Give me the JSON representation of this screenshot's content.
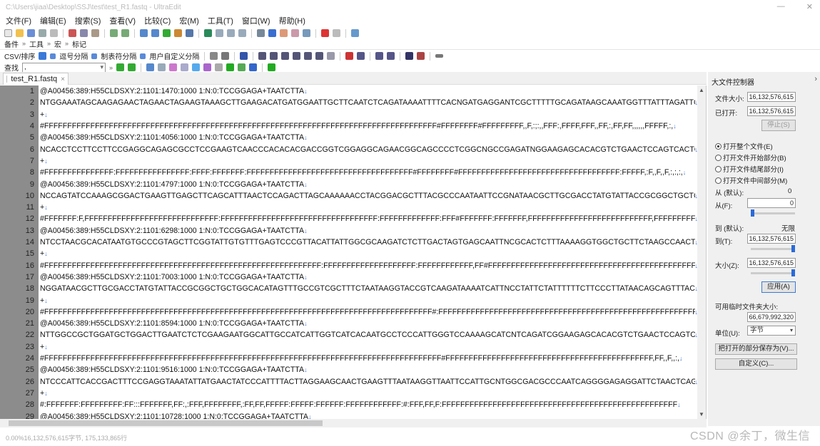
{
  "window": {
    "title": "C:\\Users\\jiaa\\Desktop\\SSJ\\test\\test_R1.fastq - UltraEdit"
  },
  "menu": [
    "文件(F)",
    "编辑(E)",
    "搜索(S)",
    "查看(V)",
    "比较(C)",
    "宏(M)",
    "工具(T)",
    "窗口(W)",
    "帮助(H)"
  ],
  "toolbar2": {
    "items": [
      "备件",
      "工具",
      "宏",
      "标记"
    ]
  },
  "toolbar3": {
    "csv": "CSV/排序",
    "sep1": "逗号分隔",
    "sep2": "制表符分隔",
    "sep3": "用户自定义分隔"
  },
  "toolbar4": {
    "find_label": "查找",
    "find_value": ","
  },
  "tab": {
    "label": "test_R1.fastq",
    "close": "×"
  },
  "editor": {
    "lines": [
      {
        "n": "1",
        "text": "@A00456:389:H55CLDSXY:2:1101:1470:1000 1:N:0:TCCGGAGA+TAATCTTA"
      },
      {
        "n": "2",
        "text": "NTGGAAATAGCAAGAGAACTAGAACTAGAAGTAAAGCTTGAAGACATGATGGAATTGCTTCAATCTCAGATAAAATTTTCACNGATGAGGANTCGCTTTTTGCAGATAAGCAAATGGTTTATTTAGATTGTAT"
      },
      {
        "n": "3",
        "text": "+"
      },
      {
        "n": "4",
        "text": "#FFFFFFFFFFFFFFFFFFFFFFFFFFFFFFFFFFFFFFFFFFFFFFFFFFFFFFFFFFFFFFFFFFFFFFFFFFFFFFFFFFFFF#FFFFFFFF#FFFFFFFFF,,F,:;:,,FFF:,FFFF,FFF,,FF,:,FF,FF,,,,,,FFFFF,:,"
      },
      {
        "n": "5",
        "text": "@A00456:389:H55CLDSXY:2:1101:4056:1000 1:N:0:TCCGGAGA+TAATCTTA"
      },
      {
        "n": "6",
        "text": "NCACCTCCTTCCTTCCGAGGCAGAGCGCCTCCGAAGTCAACCCACACACGACCGGTCGGAGGCAGAACGGCAGCCCCTCGGCNGCCGAGATNGGAAGAGCACACGTCTGAACTCCAGTCACTCCGGAGAAT"
      },
      {
        "n": "7",
        "text": "+"
      },
      {
        "n": "8",
        "text": "#FFFFFFFFFFFFFFF:FFFFFFFFFFFFFFFF:FFFF:FFFFFFF:FFFFFFFFFFFFFFFFFFFFFFFFFFFFFFFFFFFF#FFFFFFFF#FFFFFFFFFFFFFFFFFFFFFFFFFFFFFFFFFFF:FFFFF,:F,,F,,F,:,:,:,"
      },
      {
        "n": "9",
        "text": "@A00456:389:H55CLDSXY:2:1101:4797:1000 1:N:0:TCCGGAGA+TAATCTTA"
      },
      {
        "n": "10",
        "text": "NCCAGTATCCAAAGCGGACTGAAGTTGAGCTTCAGCATTTAACTCCAGACTTAGCAAAAAACCTACGGACGCTTTACGCCCAATAATTCCGNATAACGCTTGCGACCTATGTATTACCGCGGCTGCTGGCACAT"
      },
      {
        "n": "11",
        "text": "+"
      },
      {
        "n": "12",
        "text": "#FFFFFFF:F,FFFFFFFFFFFFFFFFFFFFFFFFFFFFF:FFFFFFFFFFFFFFFFFFFFFFFFFFFFFFFFFF:FFFFFFFFFFFFF:FFF#FFFFFFF:FFFFFFF,FFFFFFFFFFFFFFFFFFFFFFFFFFF,FFFFFFFFFFFFFF:FF"
      },
      {
        "n": "13",
        "text": "@A00456:389:H55CLDSXY:2:1101:6298:1000 1:N:0:TCCGGAGA+TAATCTTA"
      },
      {
        "n": "14",
        "text": "NTCCTAACGCACATAATGTGCCCGTAGCTTCGGTATTGTGTTTGAGTCCCGTTACATTATTGGCGCAAGATCTCTTGACTAGTGAGCAATTNCGCACTCTTTAAAAGGTGGCTGCTTCTAAGCCAACTTCTAGT"
      },
      {
        "n": "15",
        "text": "+"
      },
      {
        "n": "16",
        "text": "#FFFFFFFFFFFFFFFFFFFFFFFFFFFFFFFFFFFFFFFFFFFFFFFFFFFFFFFFFFFF:FFFFFFFFFFFFFFFFFFFF:FFFFFFFFFFFF,FF#FFFFFFFFFFFFFFFFFFFFFFFFFFFFFFFFFFFFFFFFFFFFFFFFFF"
      },
      {
        "n": "17",
        "text": "@A00456:389:H55CLDSXY:2:1101:7003:1000 1:N:0:TCCGGAGA+TAATCTTA"
      },
      {
        "n": "18",
        "text": "NGGATAACGCTTGCGACCTATGTATTACCGCGGCTGCTGGCACATAGTTTGCCGTCGCTTTCTAATAAGGTACCGTCAAGATAAAATCATTNCCTATTCTATTTTTTCTTCCCTTATAACAGCAGTTTACATTCCG"
      },
      {
        "n": "19",
        "text": "+"
      },
      {
        "n": "20",
        "text": "#FFFFFFFFFFFFFFFFFFFFFFFFFFFFFFFFFFFFFFFFFFFFFFFFFFFFFFFFFFFFFFFFFFFFFFFFFFFFFFFFFFFF#:FFFFFFFFFFFFFFFFFFFFFFFFFFFFFFFFFFFFFFFFFFFFFFFFFFFFFFFFFFFF"
      },
      {
        "n": "21",
        "text": "@A00456:389:H55CLDSXY:2:1101:8594:1000 1:N:0:TCCGGAGA+TAATCTTA"
      },
      {
        "n": "22",
        "text": "NTTGGCCGCTGGATGCTGGACTTGAATCTCTCGAAGAATGGCATTGCCATCATTGGTCATCACAATGCCTCCCATTGGGTCCAAAAGCATCNTCAGATCGGAAGAGCACACGTCTGAACTCCAGTCACTCCGG"
      },
      {
        "n": "23",
        "text": "+"
      },
      {
        "n": "24",
        "text": "#FFFFFFFFFFFFFFFFFFFFFFFFFFFFFFFFFFFFFFFFFFFFFFFFFFFFFFFFFFFFFFFFFFFFFFFFFFFFFFFFFFFFFF#FFFFFFFFFFFFFFFFFFFFFFFFFFFFFFFFFFFFFFFFFFFFF,FF,,F,,:,"
      },
      {
        "n": "25",
        "text": "@A00456:389:H55CLDSXY:2:1101:9516:1000 1:N:0:TCCGGAGA+TAATCTTA"
      },
      {
        "n": "26",
        "text": "NTCCCATTCACCGACTTTCCGAGGTAAATATTATGAACTATCCCATTTTACTTAGGAAGCAACTGAAGTTTAATAAGGTTAATTCCATTGCNTGGCGACGCCCAATCAGGGGAGAGGATTCTAACTCAGTAATC"
      },
      {
        "n": "27",
        "text": "+"
      },
      {
        "n": "28",
        "text": "#:FFFFFFF:FFFFFFFFF:FF:::FFFFFFF,FF:,:FFF,FFFFFFFF,:FF,FF,FFFFF:FFFFF:FFFFFF:FFFFFFFFFFFF:#:FFF,FF,F:FFFFFFFFFFFFFFFFFFFFFFFFFFFFFFFFFFFFFFFFFFFFFFFFFFF"
      },
      {
        "n": "29",
        "text": "@A00456:389:H55CLDSXY:2:1101:10728:1000 1:N:0:TCCGGAGA+TAATCTTA"
      }
    ]
  },
  "panel": {
    "title": "大文件控制器",
    "size_label": "文件大小:",
    "size_value": "16,132,576,615",
    "opened_label": "已打开:",
    "opened_value": "16,132,576,615",
    "stop_btn": "停止(S)",
    "radios": [
      "打开整个文件(E)",
      "打开文件开始部分(B)",
      "打开文件结尾部分(I)",
      "打开文件中间部分(M)"
    ],
    "from_default_label": "从 (默认):",
    "from_default_value": "0",
    "from_label": "从(F):",
    "from_value": "0",
    "to_default_label": "到 (默认):",
    "to_default_value": "无限",
    "to_label": "到(T):",
    "to_value": "16,132,576,615",
    "size2_label": "大小(Z):",
    "size2_value": "16,132,576,615",
    "apply_btn": "应用(A)",
    "temp_label": "可用临时文件夹大小:",
    "temp_value": "66,679,992,320",
    "unit_label": "单位(U):",
    "unit_value": "字节",
    "save_btn": "把打开的部分保存为(V)...",
    "custom_btn": "自定义(C)..."
  },
  "status": {
    "text": "0.00%16,132,576,615字节, 175,133,865行"
  },
  "watermark": "CSDN @余丁，微生信"
}
